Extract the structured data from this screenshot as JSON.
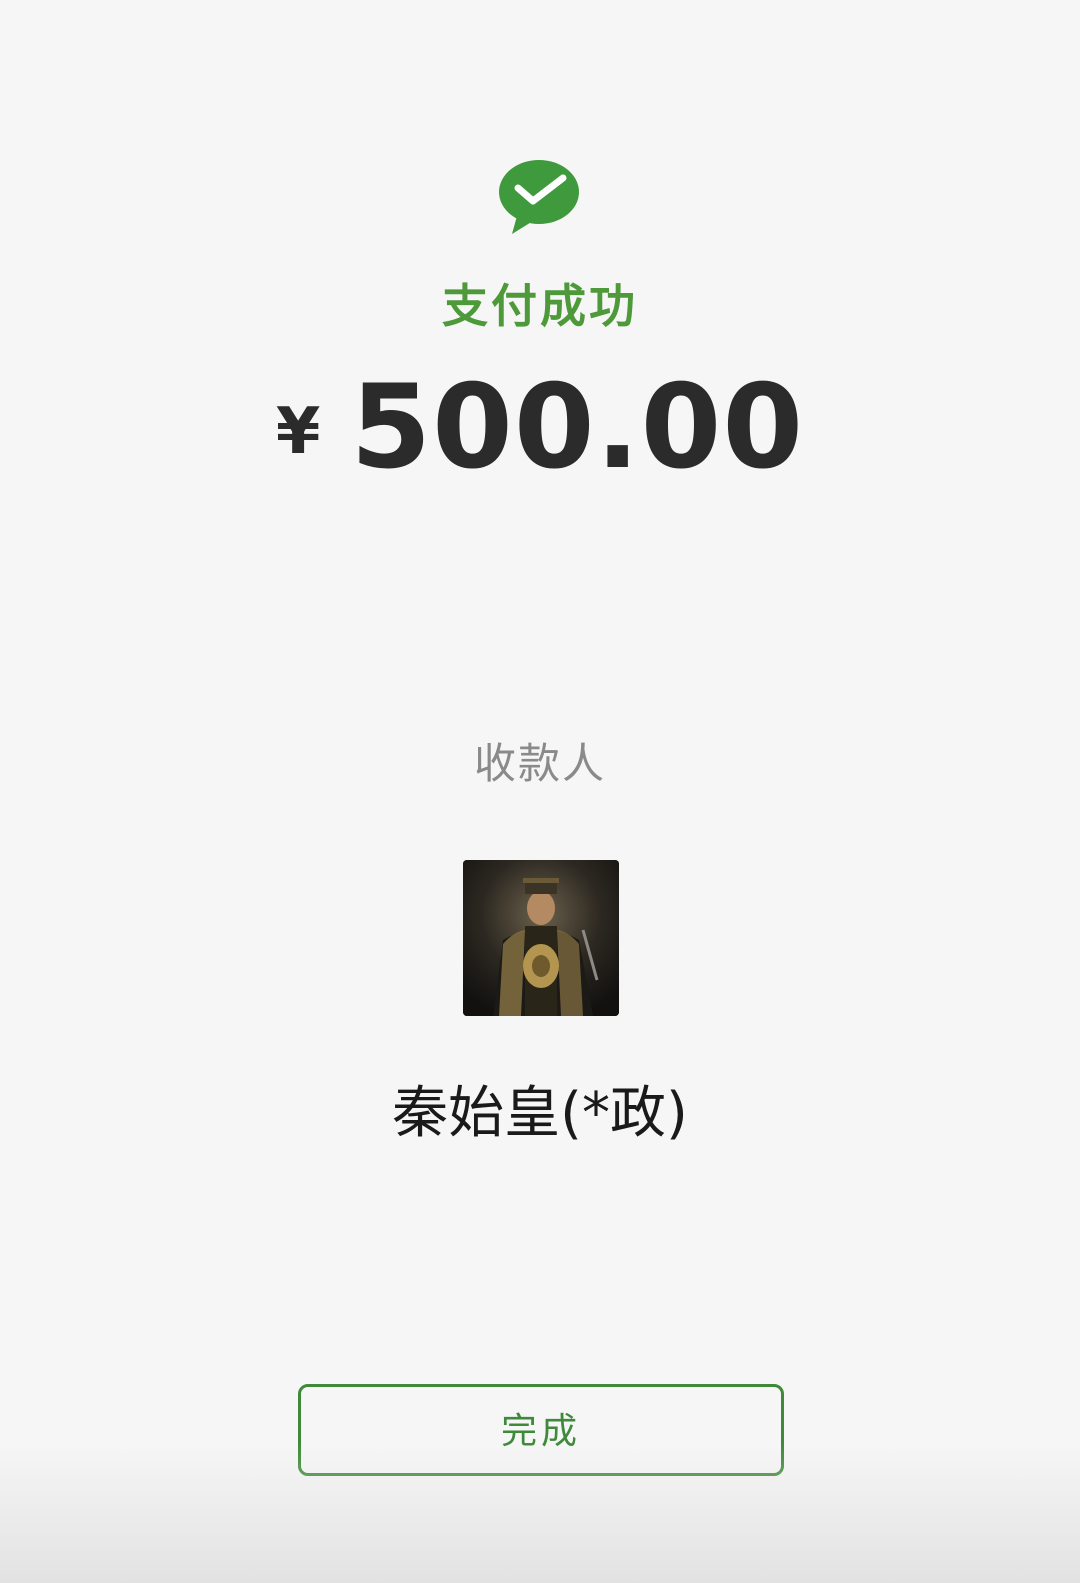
{
  "status": {
    "title": "支付成功",
    "icon": "wechat-pay-check-icon",
    "color": "#4e9a3b"
  },
  "amount": {
    "currency": "¥",
    "value": "500.00"
  },
  "payee": {
    "label": "收款人",
    "name": "秦始皇(*政)",
    "avatar": "emperor-portrait-avatar"
  },
  "actions": {
    "done_label": "完成",
    "accent": "#3f8a3a"
  }
}
